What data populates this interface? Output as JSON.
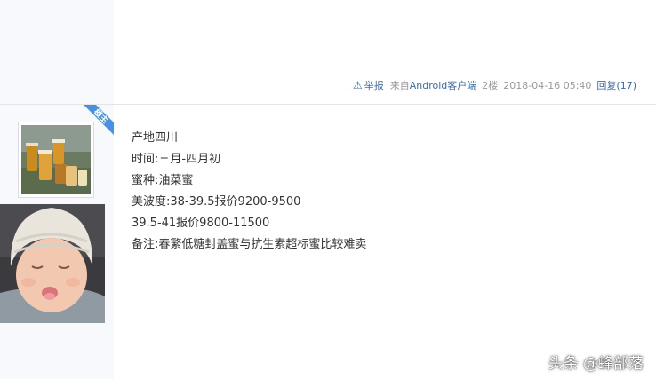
{
  "previous_post": {
    "report_label": "举报",
    "client_prefix": "来自",
    "client_link": "Android客户端",
    "floor": "2楼",
    "timestamp": "2018-04-16 05:40",
    "reply_label": "回复(17)"
  },
  "post": {
    "author_badge": "楼主",
    "lines": [
      "产地四川",
      "时间:三月-四月初",
      "蜜种:油菜蜜",
      "美波度:38-39.5报价9200-9500",
      "39.5-41报价9800-11500",
      "备注:春繁低糖封盖蜜与抗生素超标蜜比较难卖"
    ]
  },
  "watermark": "头条 @蜂部落",
  "colors": {
    "sidebar_bg": "#f7f9fc",
    "link": "#3f6aa7",
    "badge": "#4a90e2",
    "meta": "#999999"
  },
  "icons": [
    "warning-icon",
    "op-badge-ribbon"
  ]
}
